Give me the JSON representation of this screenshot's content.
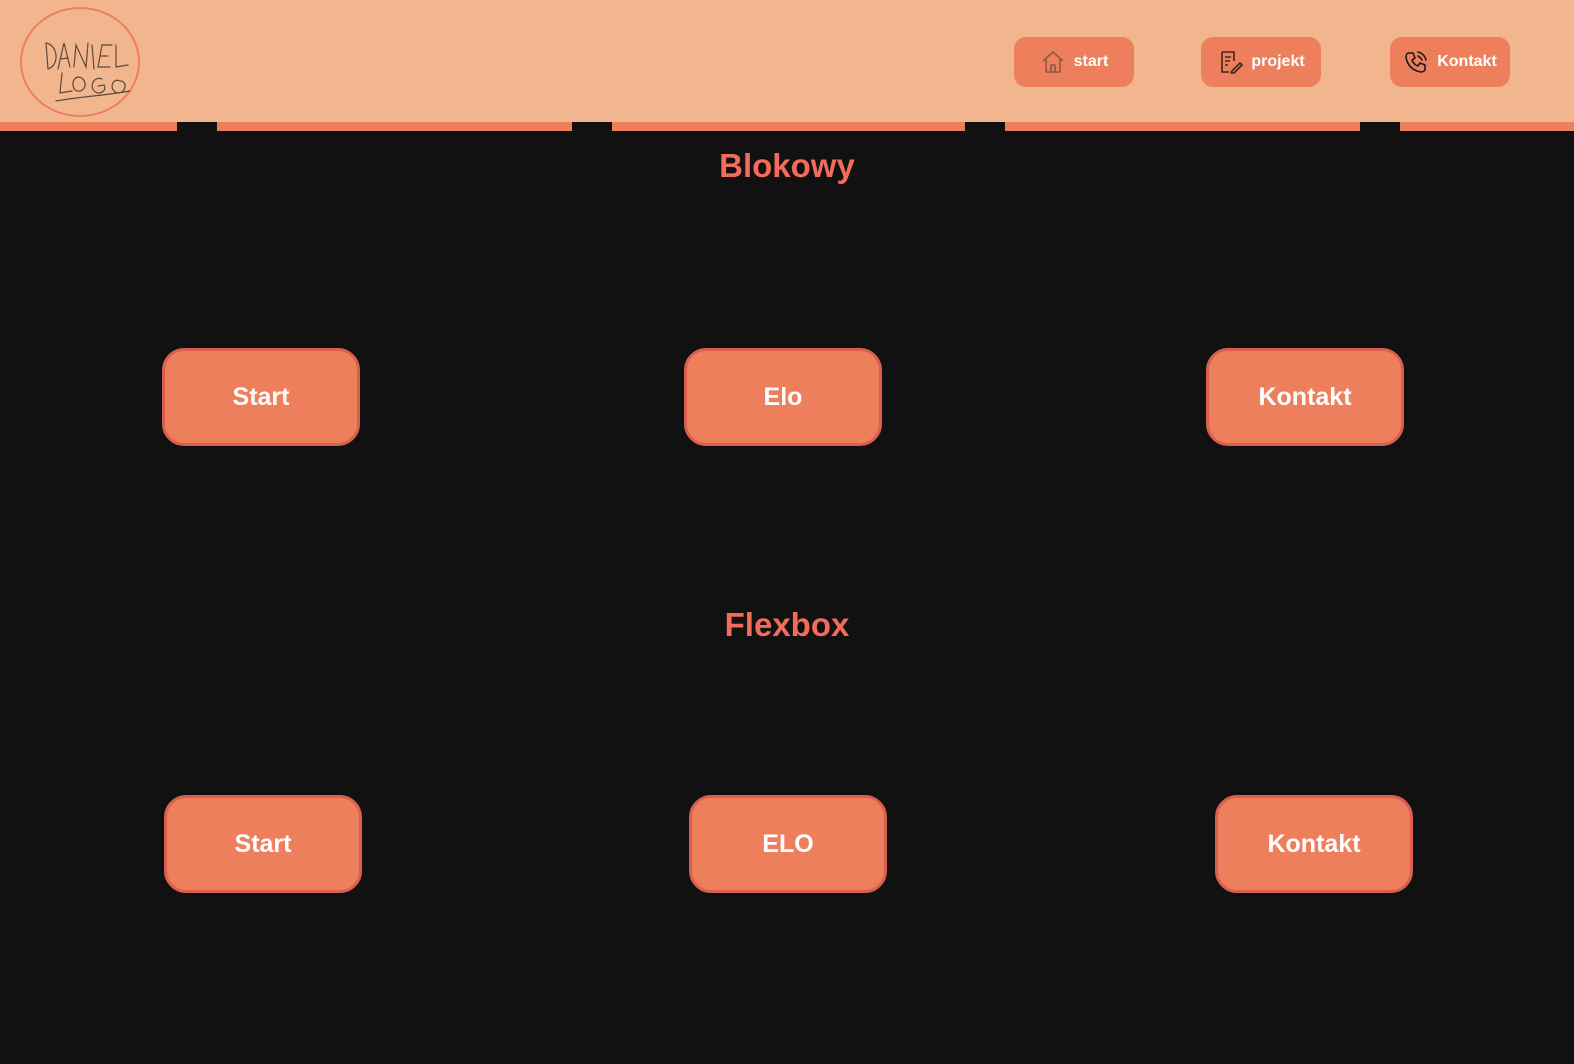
{
  "header": {
    "logo_text": [
      "DANIEL",
      "LOGO"
    ],
    "nav": [
      {
        "label": "start",
        "icon": "home-icon"
      },
      {
        "label": "projekt",
        "icon": "document-edit-icon"
      },
      {
        "label": "Kontakt",
        "icon": "phone-icon"
      }
    ]
  },
  "sections": [
    {
      "title": "Blokowy",
      "buttons": [
        "Start",
        "Elo",
        "Kontakt"
      ]
    },
    {
      "title": "Flexbox",
      "buttons": [
        "Start",
        "ELO",
        "Kontakt"
      ]
    }
  ],
  "colors": {
    "background": "#111111",
    "header_bg": "#f2b68e",
    "accent": "#ee7f5c",
    "title": "#f26b5b",
    "button_border": "#d9604f",
    "text_light": "#ffffff"
  }
}
